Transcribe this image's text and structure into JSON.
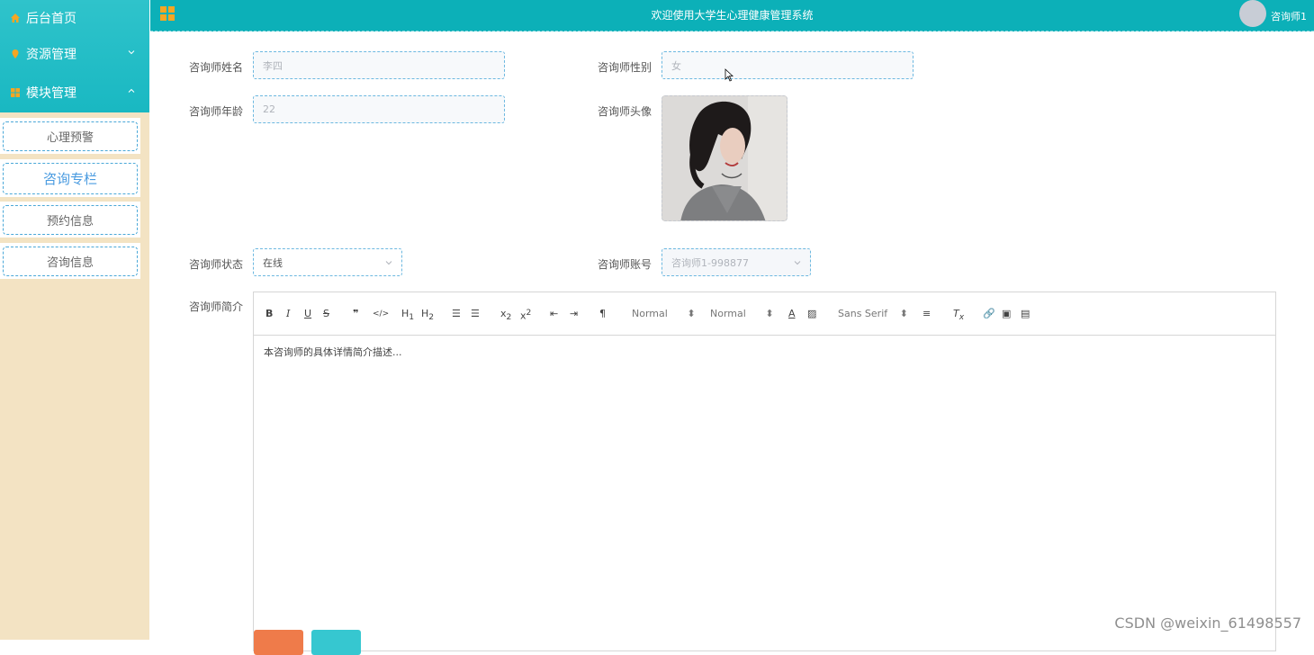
{
  "sidebar": {
    "menu": [
      {
        "label": "后台首页",
        "icon": "home-icon"
      },
      {
        "label": "资源管理",
        "icon": "location-icon"
      },
      {
        "label": "模块管理",
        "icon": "grid-icon"
      }
    ],
    "sub_items": [
      {
        "label": "心理预警"
      },
      {
        "label": "咨询专栏"
      },
      {
        "label": "预约信息"
      },
      {
        "label": "咨询信息"
      }
    ]
  },
  "header": {
    "title": "欢迎使用大学生心理健康管理系统",
    "username": "咨询师1"
  },
  "form": {
    "name_label": "咨询师姓名",
    "name_value": "李四",
    "gender_label": "咨询师性别",
    "gender_value": "女",
    "age_label": "咨询师年龄",
    "age_value": "22",
    "avatar_label": "咨询师头像",
    "status_label": "咨询师状态",
    "status_value": "在线",
    "account_label": "咨询师账号",
    "account_value": "咨询师1-998877",
    "intro_label": "咨询师简介"
  },
  "editor": {
    "font_size_1": "Normal",
    "font_size_2": "Normal",
    "font_family": "Sans Serif",
    "content": "本咨询师的具体详情简介描述..."
  },
  "buttons": {
    "submit_color": "#ef7b4a",
    "reset_color": "#36c7d0"
  },
  "watermark": "CSDN @weixin_61498557",
  "colors": {
    "primary": "#0cb0b8",
    "sidebar_bg": "#f3e3c3",
    "accent": "#f5a623"
  }
}
